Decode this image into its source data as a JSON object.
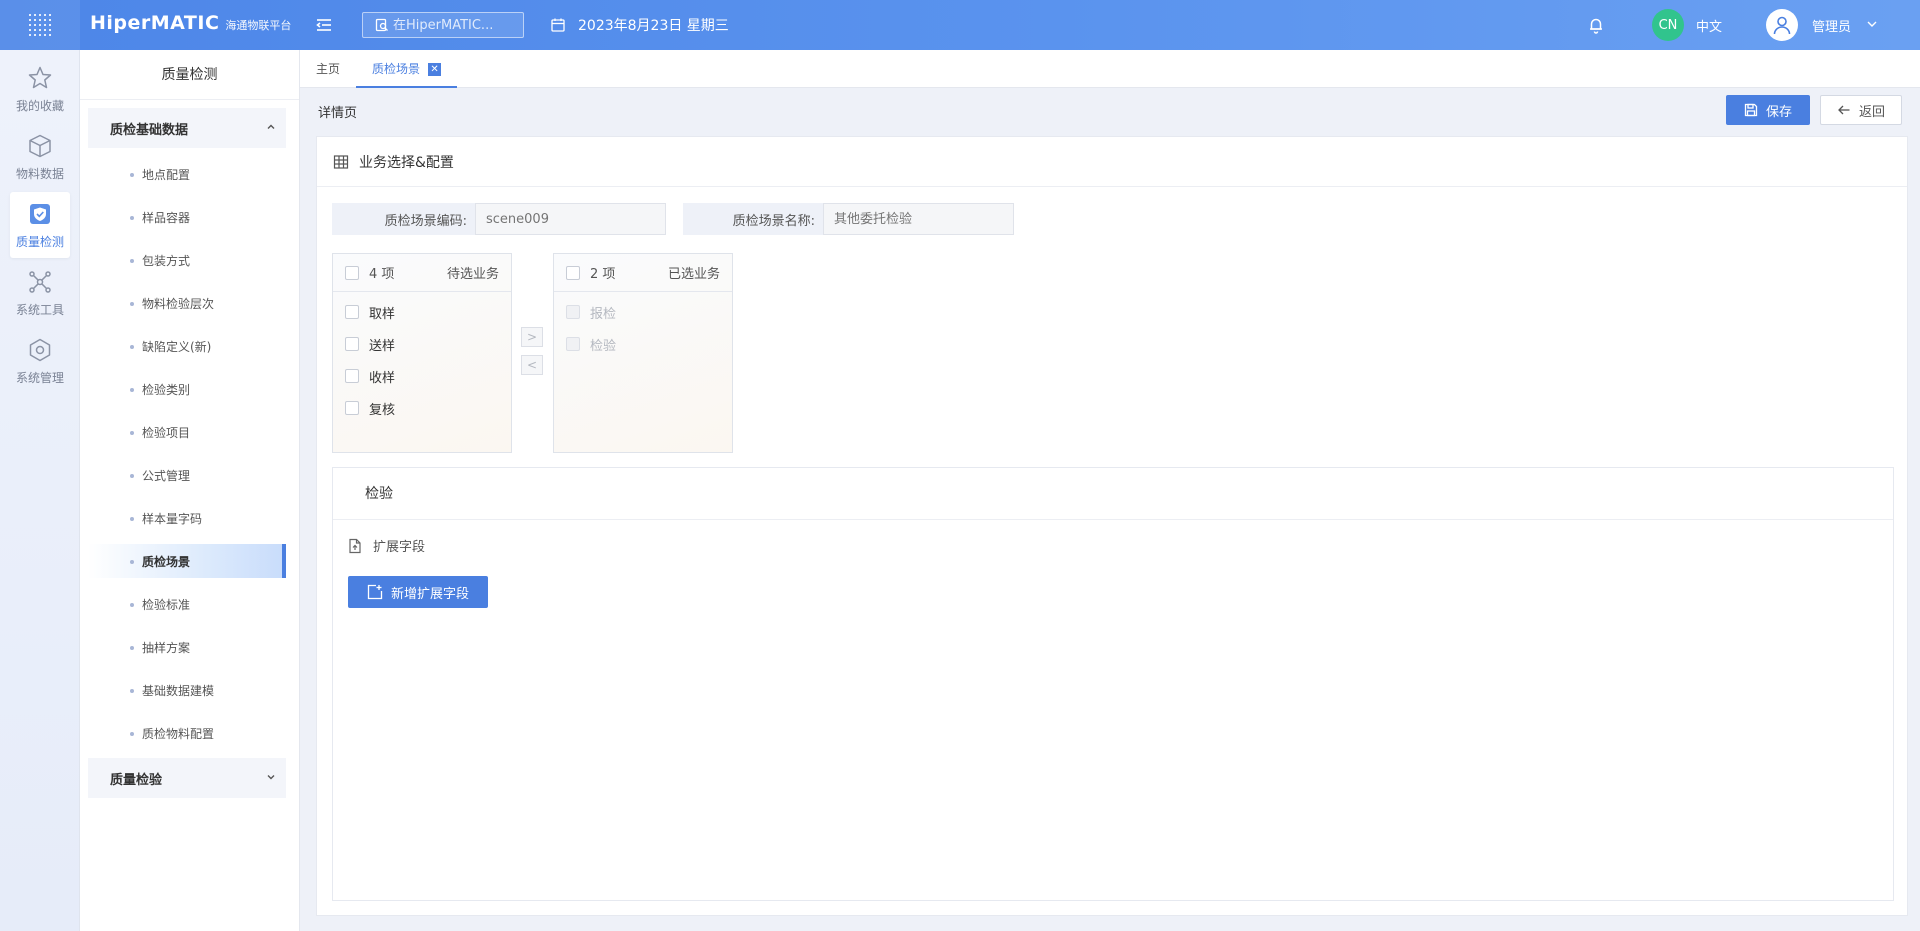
{
  "header": {
    "brand": "HiperMATIC",
    "brand_sub": "海通物联平台",
    "search_placeholder": "在HiperMATIC...",
    "date": "2023年8月23日 星期三",
    "lang_badge": "CN",
    "lang_label": "中文",
    "user_name": "管理员"
  },
  "rail": {
    "items": [
      {
        "label": "我的收藏",
        "icon": "star-icon"
      },
      {
        "label": "物料数据",
        "icon": "cube-icon"
      },
      {
        "label": "质量检测",
        "icon": "shield-check-icon"
      },
      {
        "label": "系统工具",
        "icon": "network-icon"
      },
      {
        "label": "系统管理",
        "icon": "gear-cube-icon"
      }
    ],
    "active_index": 2
  },
  "submenu": {
    "title": "质量检测",
    "group1": "质检基础数据",
    "items": [
      "地点配置",
      "样品容器",
      "包装方式",
      "物料检验层次",
      "缺陷定义(新)",
      "检验类别",
      "检验项目",
      "公式管理",
      "样本量字码",
      "质检场景",
      "检验标准",
      "抽样方案",
      "基础数据建模",
      "质检物料配置"
    ],
    "active_index": 9,
    "group2": "质量检验"
  },
  "tabs": {
    "home": "主页",
    "active": "质检场景"
  },
  "page": {
    "title": "详情页",
    "save": "保存",
    "back": "返回"
  },
  "card": {
    "title": "业务选择&配置",
    "code_label": "质检场景编码:",
    "code_value": "scene009",
    "name_label": "质检场景名称:",
    "name_value": "其他委托检验"
  },
  "transfer": {
    "left": {
      "count": "4 项",
      "title": "待选业务",
      "items": [
        "取样",
        "送样",
        "收样",
        "复核"
      ]
    },
    "right": {
      "count": "2 项",
      "title": "已选业务",
      "items": [
        "报检",
        "检验"
      ]
    },
    "to_right": ">",
    "to_left": "<"
  },
  "section": {
    "title": "检验",
    "ext_label": "扩展字段",
    "add_button": "新增扩展字段"
  },
  "colors": {
    "primary": "#4a7fe0",
    "header_gradient_start": "#4d86e8",
    "header_gradient_end": "#6aa0f2",
    "lang_badge": "#31c48d"
  }
}
